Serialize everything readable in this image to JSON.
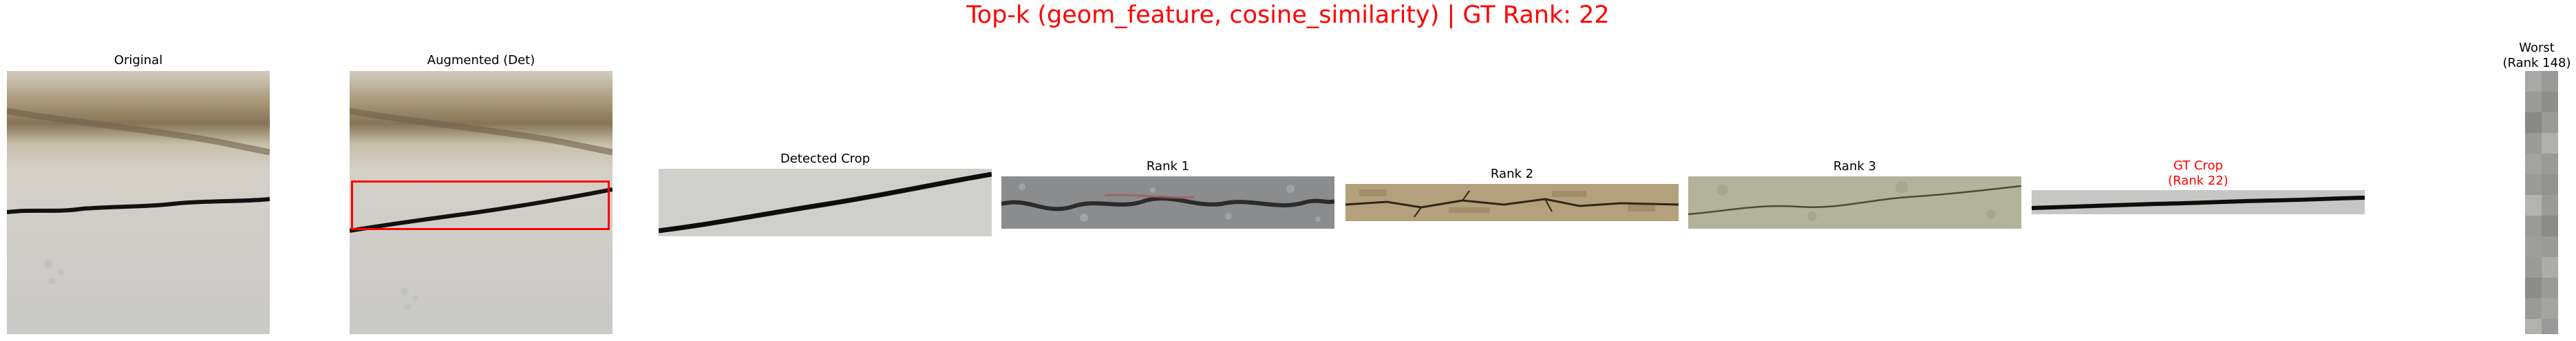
{
  "figure": {
    "title": "Top-k (geom_feature, cosine_similarity) | GT Rank: 22",
    "title_color": "#ff0000"
  },
  "panels": {
    "original": {
      "label": "Original"
    },
    "augmented": {
      "label": "Augmented (Det)",
      "box_color": "#ff0000"
    },
    "detected_crop": {
      "label": "Detected Crop"
    },
    "rank1": {
      "label": "Rank 1"
    },
    "rank2": {
      "label": "Rank 2"
    },
    "rank3": {
      "label": "Rank 3"
    },
    "gt_crop": {
      "label_line1": "GT Crop",
      "label_line2": "(Rank 22)",
      "label_color": "#ff0000"
    },
    "worst": {
      "label_line1": "Worst",
      "label_line2": "(Rank 148)"
    }
  }
}
